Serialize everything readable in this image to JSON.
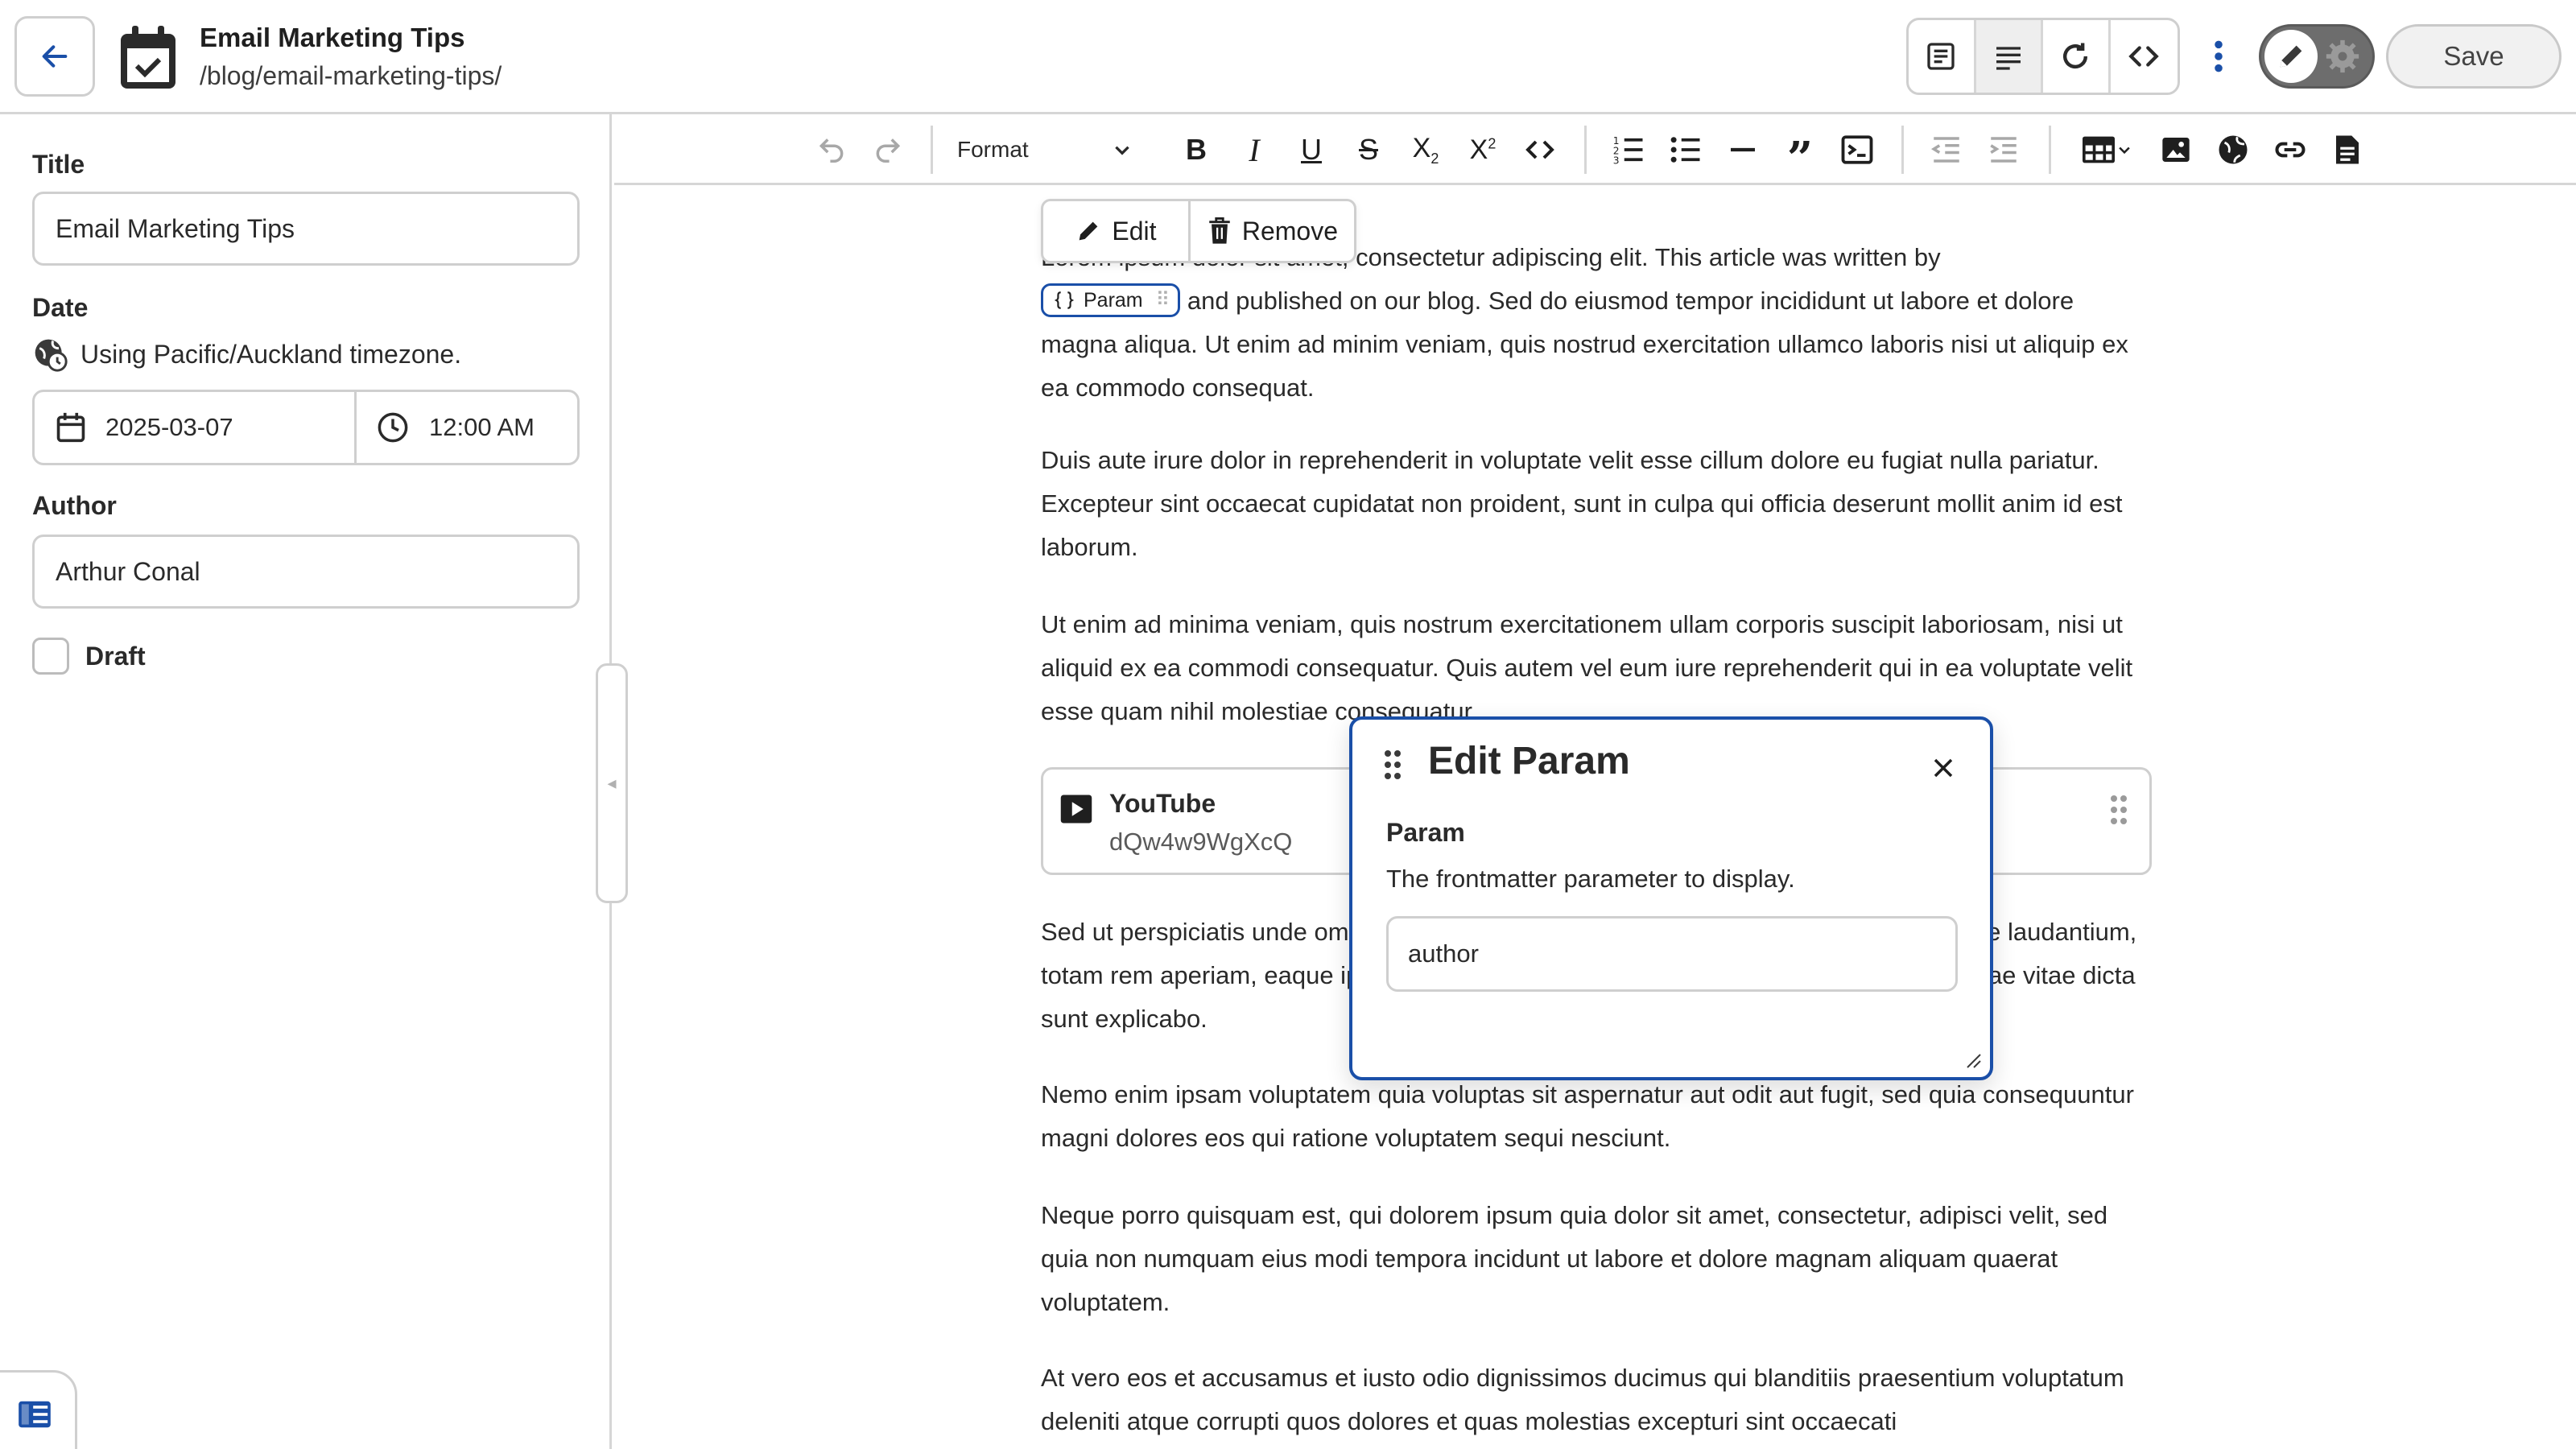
{
  "header": {
    "title": "Email Marketing Tips",
    "path": "/blog/email-marketing-tips/",
    "save_label": "Save"
  },
  "sidebar": {
    "title_label": "Title",
    "title_value": "Email Marketing Tips",
    "date_label": "Date",
    "timezone_note": "Using Pacific/Auckland timezone.",
    "date_value": "2025-03-07",
    "time_value": "12:00 AM",
    "author_label": "Author",
    "author_value": "Arthur Conal",
    "draft_label": "Draft"
  },
  "toolbar": {
    "format_label": "Format"
  },
  "editor": {
    "popover_edit": "Edit",
    "popover_remove": "Remove",
    "p1_before": "Lorem ipsum dolor sit amet, consectetur adipiscing elit. This article was written by",
    "param_chip": "Param",
    "p1_after": "and published on our blog. Sed do eiusmod tempor incididunt ut labore et dolore magna aliqua. Ut enim ad minim veniam, quis nostrud exercitation ullamco laboris nisi ut aliquip ex ea commodo consequat.",
    "p2": "Duis aute irure dolor in reprehenderit in voluptate velit esse cillum dolore eu fugiat nulla pariatur. Excepteur sint occaecat cupidatat non proident, sunt in culpa qui officia deserunt mollit anim id est laborum.",
    "p3": "Ut enim ad minima veniam, quis nostrum exercitationem ullam corporis suscipit laboriosam, nisi ut aliquid ex ea commodi consequatur. Quis autem vel eum iure reprehenderit qui in ea voluptate velit esse quam nihil molestiae consequatur.",
    "youtube_title": "YouTube",
    "youtube_id": "dQw4w9WgXcQ",
    "p4": "Sed ut perspiciatis unde omnis iste natus error sit voluptatem accusantium doloremque laudantium, totam rem aperiam, eaque ipsa quae ab illo inventore veritatis et quasi architecto beatae vitae dicta sunt explicabo.",
    "p5": "Nemo enim ipsam voluptatem quia voluptas sit aspernatur aut odit aut fugit, sed quia consequuntur magni dolores eos qui ratione voluptatem sequi nesciunt.",
    "p6": "Neque porro quisquam est, qui dolorem ipsum quia dolor sit amet, consectetur, adipisci velit, sed quia non numquam eius modi tempora incidunt ut labore et dolore magnam aliquam quaerat voluptatem.",
    "p7": "At vero eos et accusamus et iusto odio dignissimos ducimus qui blanditiis praesentium voluptatum deleniti atque corrupti quos dolores et quas molestias excepturi sint occaecati"
  },
  "dialog": {
    "title": "Edit Param",
    "field_label": "Param",
    "help_text": "The frontmatter parameter to display.",
    "value": "author"
  },
  "colors": {
    "accent": "#1a4fa8",
    "border": "#cfcfcf",
    "toggle_bg": "#6d6d6d"
  }
}
